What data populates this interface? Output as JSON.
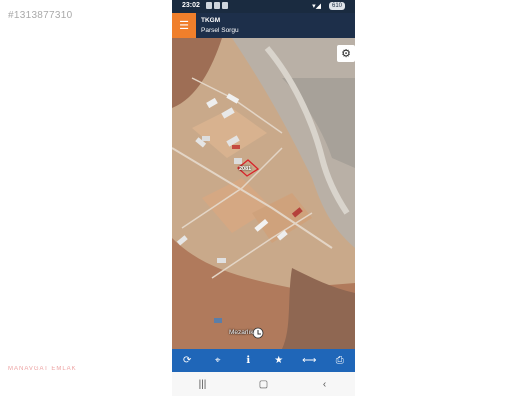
{
  "listing_id": "#1313877310",
  "watermark": "MANAVGAT EMLAK",
  "status_bar": {
    "time": "23:02",
    "battery": "610"
  },
  "app_bar": {
    "title": "TKGM",
    "subtitle": "Parsel Sorgu"
  },
  "map": {
    "parcel_label": "2081",
    "place_label": "Mezarlık"
  },
  "icons": {
    "menu": "hamburger-icon",
    "settings": "gear-icon",
    "toolbar": [
      "refresh-icon",
      "locate-icon",
      "info-icon",
      "star-icon",
      "measure-icon",
      "print-icon"
    ],
    "nav": [
      "recents-icon",
      "home-icon",
      "back-icon"
    ]
  },
  "colors": {
    "app_bar": "#1d2f4a",
    "menu_button": "#f07f2b",
    "toolbar": "#1f66b8",
    "parcel_outline": "#d8232a"
  }
}
